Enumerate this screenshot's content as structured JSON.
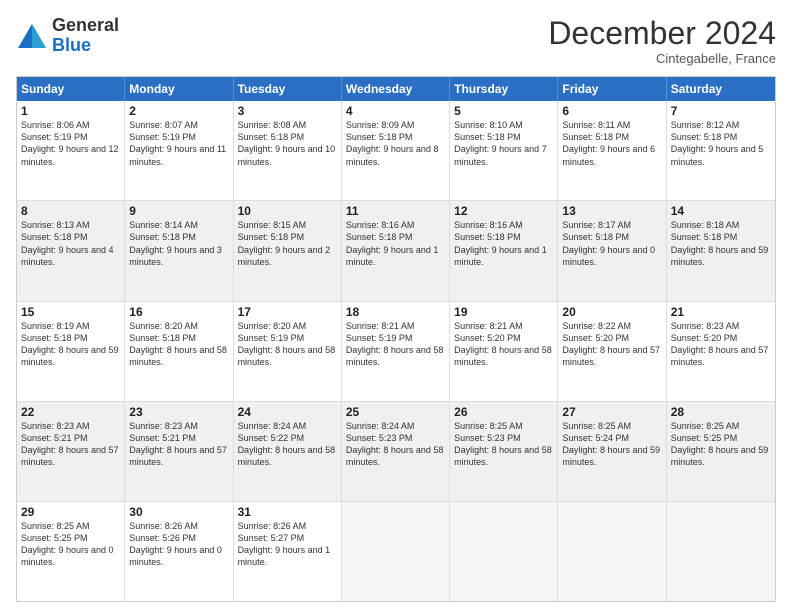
{
  "logo": {
    "general": "General",
    "blue": "Blue"
  },
  "header": {
    "title": "December 2024",
    "subtitle": "Cintegabelle, France"
  },
  "days": [
    "Sunday",
    "Monday",
    "Tuesday",
    "Wednesday",
    "Thursday",
    "Friday",
    "Saturday"
  ],
  "weeks": [
    [
      {
        "day": "1",
        "rise": "Sunrise: 8:06 AM",
        "set": "Sunset: 5:19 PM",
        "light": "Daylight: 9 hours and 12 minutes."
      },
      {
        "day": "2",
        "rise": "Sunrise: 8:07 AM",
        "set": "Sunset: 5:19 PM",
        "light": "Daylight: 9 hours and 11 minutes."
      },
      {
        "day": "3",
        "rise": "Sunrise: 8:08 AM",
        "set": "Sunset: 5:18 PM",
        "light": "Daylight: 9 hours and 10 minutes."
      },
      {
        "day": "4",
        "rise": "Sunrise: 8:09 AM",
        "set": "Sunset: 5:18 PM",
        "light": "Daylight: 9 hours and 8 minutes."
      },
      {
        "day": "5",
        "rise": "Sunrise: 8:10 AM",
        "set": "Sunset: 5:18 PM",
        "light": "Daylight: 9 hours and 7 minutes."
      },
      {
        "day": "6",
        "rise": "Sunrise: 8:11 AM",
        "set": "Sunset: 5:18 PM",
        "light": "Daylight: 9 hours and 6 minutes."
      },
      {
        "day": "7",
        "rise": "Sunrise: 8:12 AM",
        "set": "Sunset: 5:18 PM",
        "light": "Daylight: 9 hours and 5 minutes."
      }
    ],
    [
      {
        "day": "8",
        "rise": "Sunrise: 8:13 AM",
        "set": "Sunset: 5:18 PM",
        "light": "Daylight: 9 hours and 4 minutes."
      },
      {
        "day": "9",
        "rise": "Sunrise: 8:14 AM",
        "set": "Sunset: 5:18 PM",
        "light": "Daylight: 9 hours and 3 minutes."
      },
      {
        "day": "10",
        "rise": "Sunrise: 8:15 AM",
        "set": "Sunset: 5:18 PM",
        "light": "Daylight: 9 hours and 2 minutes."
      },
      {
        "day": "11",
        "rise": "Sunrise: 8:16 AM",
        "set": "Sunset: 5:18 PM",
        "light": "Daylight: 9 hours and 1 minute."
      },
      {
        "day": "12",
        "rise": "Sunrise: 8:16 AM",
        "set": "Sunset: 5:18 PM",
        "light": "Daylight: 9 hours and 1 minute."
      },
      {
        "day": "13",
        "rise": "Sunrise: 8:17 AM",
        "set": "Sunset: 5:18 PM",
        "light": "Daylight: 9 hours and 0 minutes."
      },
      {
        "day": "14",
        "rise": "Sunrise: 8:18 AM",
        "set": "Sunset: 5:18 PM",
        "light": "Daylight: 8 hours and 59 minutes."
      }
    ],
    [
      {
        "day": "15",
        "rise": "Sunrise: 8:19 AM",
        "set": "Sunset: 5:18 PM",
        "light": "Daylight: 8 hours and 59 minutes."
      },
      {
        "day": "16",
        "rise": "Sunrise: 8:20 AM",
        "set": "Sunset: 5:18 PM",
        "light": "Daylight: 8 hours and 58 minutes."
      },
      {
        "day": "17",
        "rise": "Sunrise: 8:20 AM",
        "set": "Sunset: 5:19 PM",
        "light": "Daylight: 8 hours and 58 minutes."
      },
      {
        "day": "18",
        "rise": "Sunrise: 8:21 AM",
        "set": "Sunset: 5:19 PM",
        "light": "Daylight: 8 hours and 58 minutes."
      },
      {
        "day": "19",
        "rise": "Sunrise: 8:21 AM",
        "set": "Sunset: 5:20 PM",
        "light": "Daylight: 8 hours and 58 minutes."
      },
      {
        "day": "20",
        "rise": "Sunrise: 8:22 AM",
        "set": "Sunset: 5:20 PM",
        "light": "Daylight: 8 hours and 57 minutes."
      },
      {
        "day": "21",
        "rise": "Sunrise: 8:23 AM",
        "set": "Sunset: 5:20 PM",
        "light": "Daylight: 8 hours and 57 minutes."
      }
    ],
    [
      {
        "day": "22",
        "rise": "Sunrise: 8:23 AM",
        "set": "Sunset: 5:21 PM",
        "light": "Daylight: 8 hours and 57 minutes."
      },
      {
        "day": "23",
        "rise": "Sunrise: 8:23 AM",
        "set": "Sunset: 5:21 PM",
        "light": "Daylight: 8 hours and 57 minutes."
      },
      {
        "day": "24",
        "rise": "Sunrise: 8:24 AM",
        "set": "Sunset: 5:22 PM",
        "light": "Daylight: 8 hours and 58 minutes."
      },
      {
        "day": "25",
        "rise": "Sunrise: 8:24 AM",
        "set": "Sunset: 5:23 PM",
        "light": "Daylight: 8 hours and 58 minutes."
      },
      {
        "day": "26",
        "rise": "Sunrise: 8:25 AM",
        "set": "Sunset: 5:23 PM",
        "light": "Daylight: 8 hours and 58 minutes."
      },
      {
        "day": "27",
        "rise": "Sunrise: 8:25 AM",
        "set": "Sunset: 5:24 PM",
        "light": "Daylight: 8 hours and 59 minutes."
      },
      {
        "day": "28",
        "rise": "Sunrise: 8:25 AM",
        "set": "Sunset: 5:25 PM",
        "light": "Daylight: 8 hours and 59 minutes."
      }
    ],
    [
      {
        "day": "29",
        "rise": "Sunrise: 8:25 AM",
        "set": "Sunset: 5:25 PM",
        "light": "Daylight: 9 hours and 0 minutes."
      },
      {
        "day": "30",
        "rise": "Sunrise: 8:26 AM",
        "set": "Sunset: 5:26 PM",
        "light": "Daylight: 9 hours and 0 minutes."
      },
      {
        "day": "31",
        "rise": "Sunrise: 8:26 AM",
        "set": "Sunset: 5:27 PM",
        "light": "Daylight: 9 hours and 1 minute."
      },
      {
        "day": "",
        "rise": "",
        "set": "",
        "light": ""
      },
      {
        "day": "",
        "rise": "",
        "set": "",
        "light": ""
      },
      {
        "day": "",
        "rise": "",
        "set": "",
        "light": ""
      },
      {
        "day": "",
        "rise": "",
        "set": "",
        "light": ""
      }
    ]
  ]
}
